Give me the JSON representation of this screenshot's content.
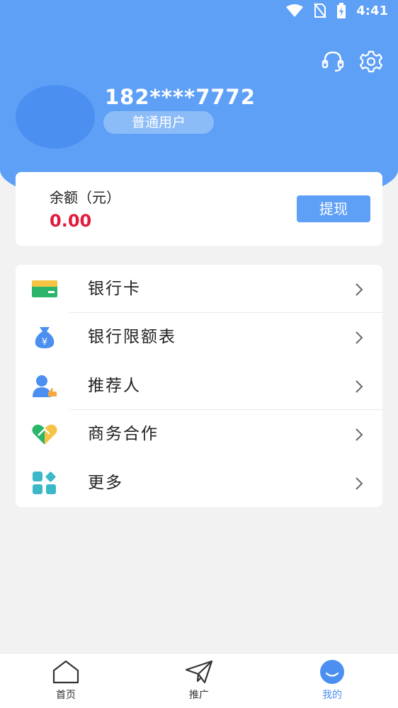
{
  "status_bar": {
    "time": "4:41",
    "icons": [
      "wifi-icon",
      "no-sim-icon",
      "battery-charging-icon"
    ]
  },
  "header": {
    "phone": "182****7772",
    "user_level": "普通用户",
    "icons": [
      "headset-icon",
      "gear-icon"
    ]
  },
  "balance": {
    "label": "余额（元）",
    "value": "0.00",
    "withdraw_label": "提现"
  },
  "menu": {
    "items": [
      {
        "label": "银行卡",
        "icon": "bank-card-icon"
      },
      {
        "label": "银行限额表",
        "icon": "money-bag-icon"
      },
      {
        "label": "推荐人",
        "icon": "referrer-icon"
      },
      {
        "label": "商务合作",
        "icon": "handshake-heart-icon"
      },
      {
        "label": "更多",
        "icon": "grid-more-icon"
      }
    ]
  },
  "bottom_nav": {
    "items": [
      {
        "label": "首页",
        "icon": "home-icon",
        "active": false
      },
      {
        "label": "推广",
        "icon": "paper-plane-icon",
        "active": false
      },
      {
        "label": "我的",
        "icon": "profile-face-icon",
        "active": true
      }
    ]
  },
  "colors": {
    "primary": "#5fa0f7",
    "balance_value": "#e01b3c",
    "background": "#f2f2f2"
  }
}
